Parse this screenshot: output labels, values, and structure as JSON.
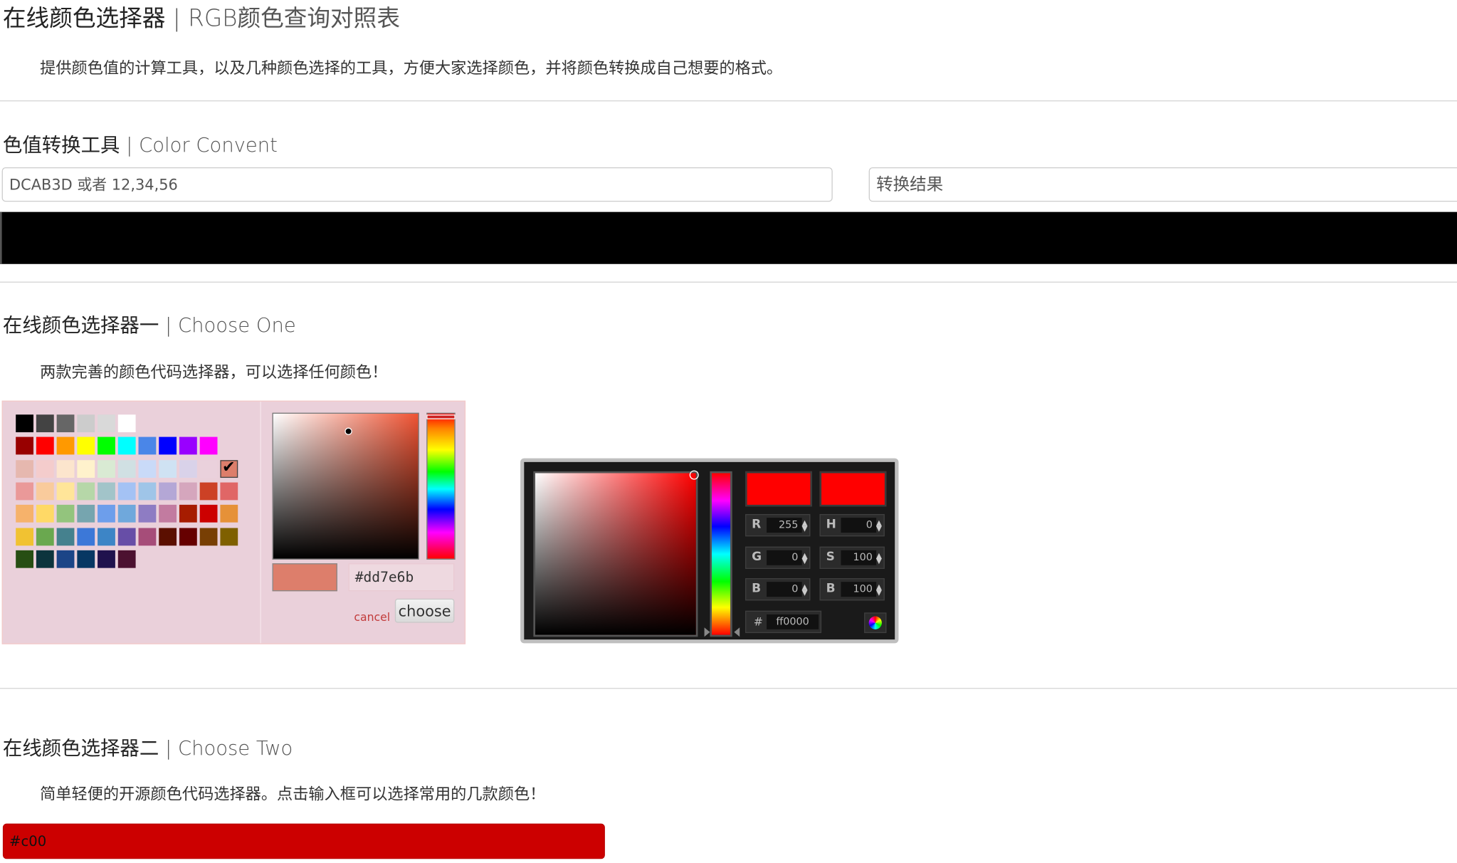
{
  "header": {
    "title": "在线颜色选择器",
    "title_sub": "RGB颜色查询对照表",
    "description": "提供颜色值的计算工具，以及几种颜色选择的工具，方便大家选择颜色，并将颜色转换成自己想要的格式。"
  },
  "converter": {
    "title": "色值转换工具",
    "title_sub": "Color Convent",
    "input_placeholder": "DCAB3D 或者 12,34,56",
    "result_placeholder": "转换结果",
    "preview_color": "#000000"
  },
  "chooser_one": {
    "title": "在线颜色选择器一",
    "title_sub": "Choose One",
    "description": "两款完善的颜色代码选择器，可以选择任何颜色！",
    "palette": [
      [
        "#000000",
        "#434343",
        "#666666",
        "#cccccc",
        "#d9d9d9",
        "#ffffff"
      ],
      [
        "#980000",
        "#ff0000",
        "#ff9900",
        "#ffff00",
        "#00ff00",
        "#00ffff",
        "#4a86e8",
        "#0000ff",
        "#9900ff",
        "#ff00ff"
      ],
      [
        "#e6b8af",
        "#f4cccc",
        "#fce5cd",
        "#fff2cc",
        "#d9ead3",
        "#d0e0e3",
        "#c9daf8",
        "#cfe2f3",
        "#d9d2e9",
        "#ead1dc",
        "#dd7e6b"
      ],
      [
        "#ea9999",
        "#f9cb9c",
        "#ffe599",
        "#b6d7a8",
        "#a2c4c9",
        "#a4c2f4",
        "#9fc5e8",
        "#b4a7d6",
        "#d5a6bd",
        "#cc4125",
        "#e06666"
      ],
      [
        "#f6b26b",
        "#ffd966",
        "#93c47d",
        "#76a5af",
        "#6d9eeb",
        "#6fa8dc",
        "#8e7cc3",
        "#c27ba0",
        "#a61c00",
        "#cc0000",
        "#e69138"
      ],
      [
        "#f1c232",
        "#6aa84f",
        "#45818e",
        "#3c78d8",
        "#3d85c6",
        "#674ea7",
        "#a64d79",
        "#5b0f00",
        "#660000",
        "#783f04",
        "#7f6000"
      ],
      [
        "#274e13",
        "#0c343d",
        "#1c4587",
        "#073763",
        "#20124d",
        "#4c1130"
      ]
    ],
    "selected_swatch": "#dd7e6b",
    "hue_color": "#ef5333",
    "preview_color": "#dd7e6b",
    "hex_value": "#dd7e6b",
    "cancel_label": "cancel",
    "choose_label": "choose"
  },
  "picker_two": {
    "current_color": "#ff0000",
    "new_color": "#ff0000",
    "fields": {
      "r": {
        "label": "R",
        "value": "255"
      },
      "g": {
        "label": "G",
        "value": "0"
      },
      "b": {
        "label": "B",
        "value": "0"
      },
      "h": {
        "label": "H",
        "value": "0"
      },
      "s": {
        "label": "S",
        "value": "100"
      },
      "bv": {
        "label": "B",
        "value": "100"
      }
    },
    "hex_label": "#",
    "hex_value": "ff0000"
  },
  "chooser_two": {
    "title": "在线颜色选择器二",
    "title_sub": "Choose Two",
    "description": "简单轻便的开源颜色代码选择器。点击输入框可以选择常用的几款颜色！",
    "input_value": "#c00",
    "input_color": "#cc0000"
  }
}
